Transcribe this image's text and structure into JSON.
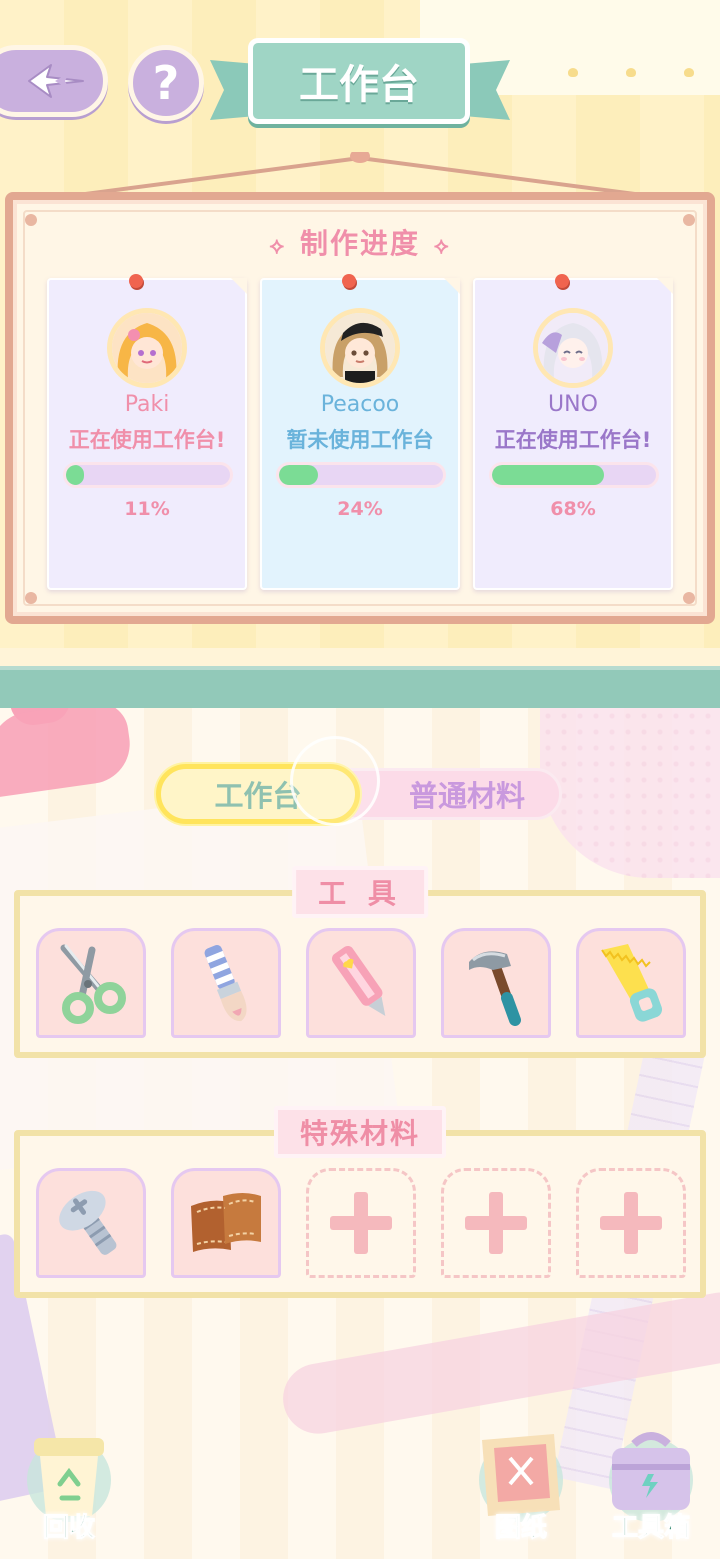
{
  "header": {
    "title": "工作台",
    "back_icon": "back-arrow-icon",
    "help_label": "?"
  },
  "progress_board": {
    "title": "制作进度",
    "players": [
      {
        "name": "Paki",
        "status": "正在使用工作台!",
        "progress": 0.11,
        "percent": "11%",
        "name_color": "#f08faa",
        "status_color": "#f08faa",
        "bg": "#f0ecfd"
      },
      {
        "name": "Peacoo",
        "status": "暂未使用工作台",
        "progress": 0.24,
        "percent": "24%",
        "name_color": "#6ab3db",
        "status_color": "#6ab3db",
        "bg": "#e2f3fd"
      },
      {
        "name": "UNO",
        "status": "正在使用工作台!",
        "progress": 0.68,
        "percent": "68%",
        "name_color": "#9a77c9",
        "status_color": "#9a77c9",
        "bg": "#f0ecfd"
      }
    ]
  },
  "tabs": {
    "active": "工作台",
    "inactive": "普通材料"
  },
  "tools": {
    "label": "工 具",
    "items": [
      "scissors-icon",
      "paintbrush-icon",
      "utility-knife-icon",
      "hammer-icon",
      "saw-icon"
    ]
  },
  "special": {
    "label": "特殊材料",
    "items": [
      "screw-icon",
      "leather-icon"
    ],
    "empty_slots": 3
  },
  "bottom_bar": {
    "recycle": "回收",
    "blueprint": "图纸",
    "toolbox": "工具箱"
  },
  "colors": {
    "accent_teal": "#9fd5c5",
    "progress_green": "#7bdc95",
    "tab_active_border": "#ffe45c",
    "pink_text": "#f08faa"
  }
}
